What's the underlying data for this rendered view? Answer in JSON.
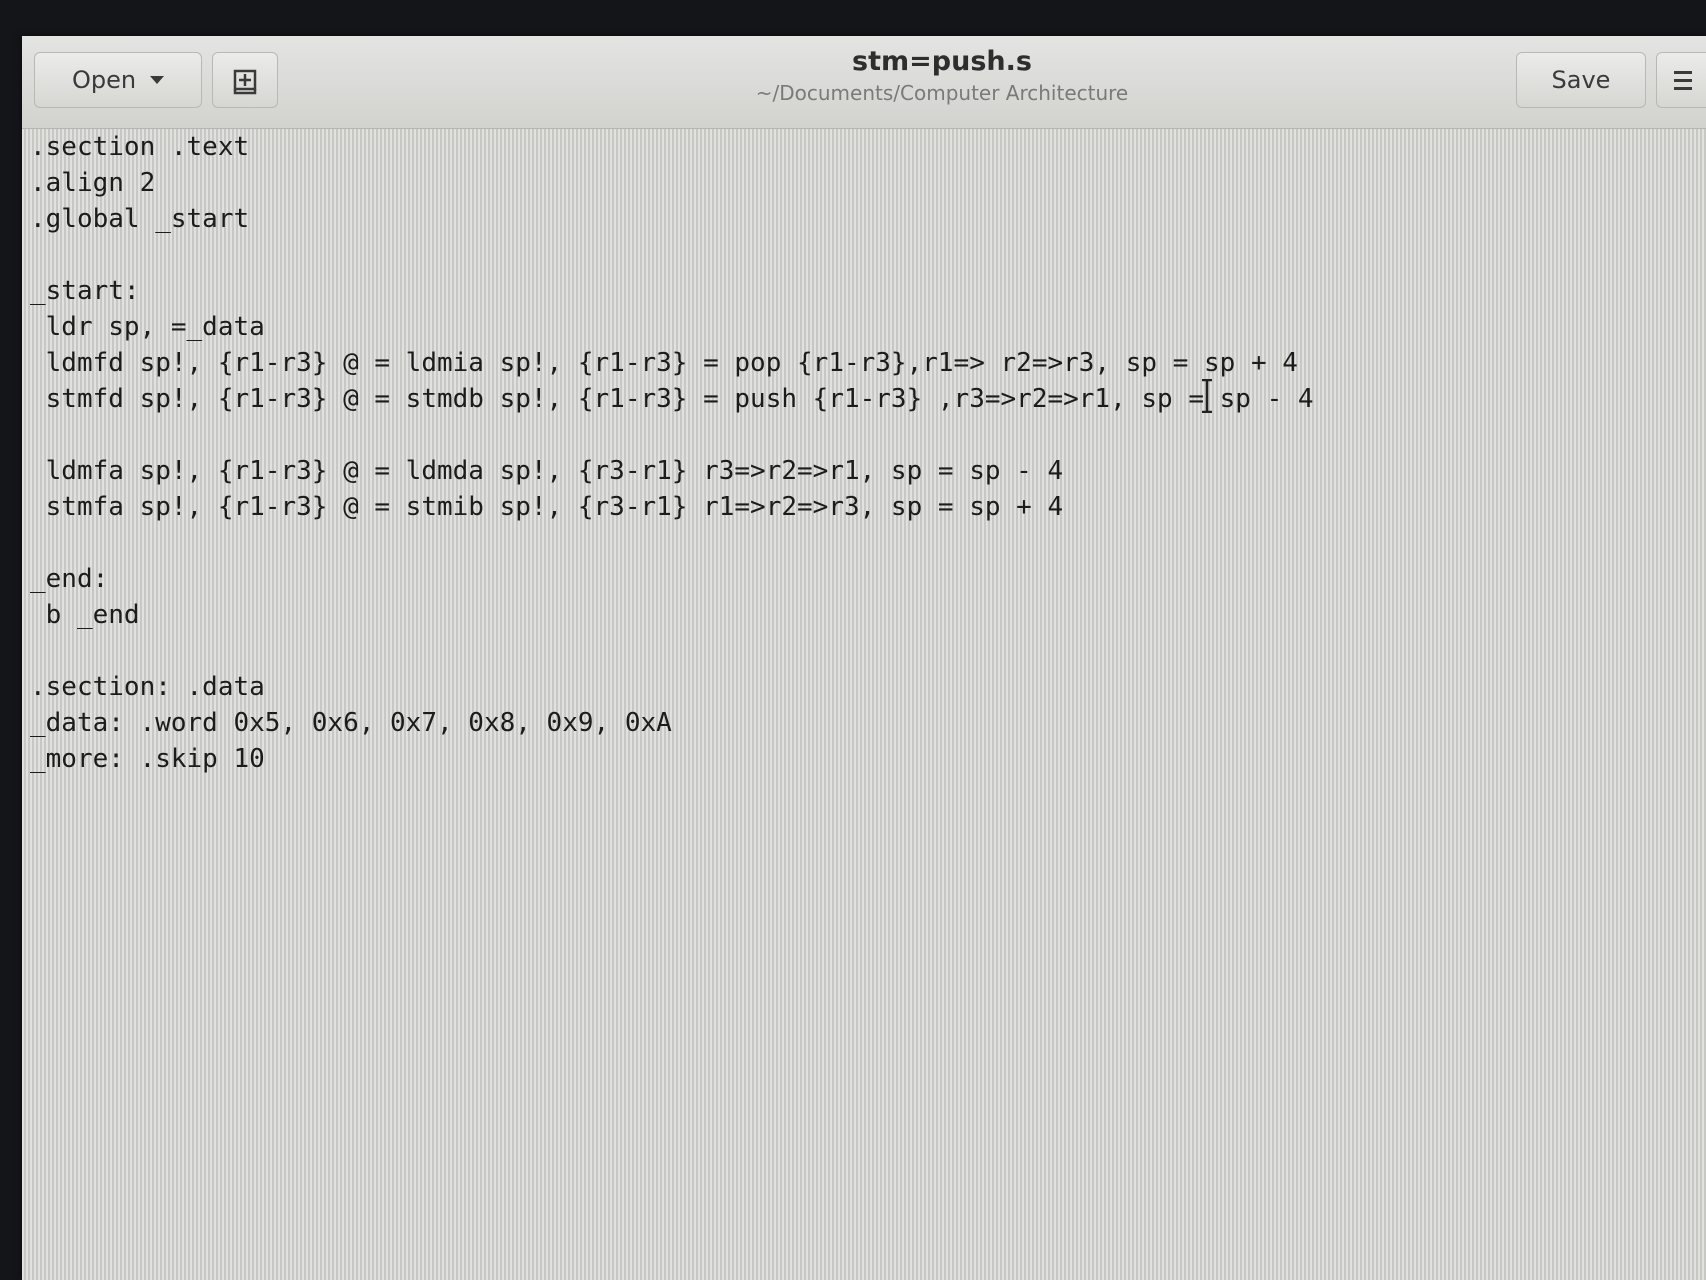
{
  "header": {
    "open_label": "Open",
    "title": "stm=push.s",
    "subtitle": "~/Documents/Computer Architecture",
    "save_label": "Save"
  },
  "editor": {
    "lines": [
      ".section .text",
      ".align 2",
      ".global _start",
      "",
      "_start:",
      " ldr sp, =_data",
      " ldmfd sp!, {r1-r3} @ = ldmia sp!, {r1-r3} = pop {r1-r3},r1=> r2=>r3, sp = sp + 4",
      " stmfd sp!, {r1-r3} @ = stmdb sp!, {r1-r3} = push {r1-r3} ,r3=>r2=>r1, sp = sp - 4",
      "",
      " ldmfa sp!, {r1-r3} @ = ldmda sp!, {r3-r1} r3=>r2=>r1, sp = sp - 4",
      " stmfa sp!, {r1-r3} @ = stmib sp!, {r3-r1} r1=>r2=>r3, sp = sp + 4",
      "",
      "_end:",
      " b _end",
      "",
      ".section: .data",
      "_data: .word 0x5, 0x6, 0x7, 0x8, 0x9, 0xA",
      "_more: .skip 10"
    ]
  },
  "icons": {
    "open_menu": "chevron-down-icon",
    "new_document": "new-document-icon",
    "menu": "hamburger-menu-icon",
    "cursor": "text-cursor-icon"
  }
}
